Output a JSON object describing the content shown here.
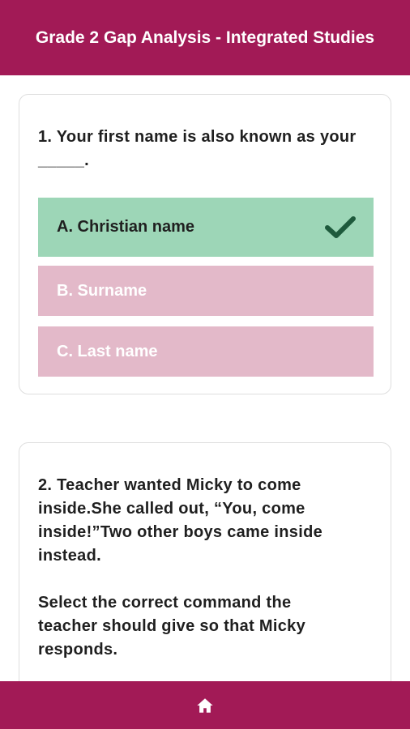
{
  "header": {
    "title": "Grade 2 Gap Analysis - Integrated Studies"
  },
  "questions": [
    {
      "text": "1. Your first name is also known as your _____.",
      "options": [
        {
          "label": "A. Christian name",
          "state": "correct"
        },
        {
          "label": "B. Surname",
          "state": "incorrect"
        },
        {
          "label": "C. Last name",
          "state": "incorrect"
        }
      ]
    },
    {
      "text_lines": [
        "2. Teacher wanted Micky to come",
        "inside.She called out, “You, come",
        "inside!”Two other boys came inside",
        "instead."
      ],
      "instruction_lines": [
        "Select the correct command the",
        "teacher should give so that Micky",
        "responds."
      ]
    }
  ],
  "bottom_nav": {
    "home_icon": "home-icon"
  },
  "colors": {
    "brand": "#a21a56",
    "correct": "#9dd6b7",
    "incorrect": "#e3b9c9",
    "check": "#1e5a3c"
  }
}
